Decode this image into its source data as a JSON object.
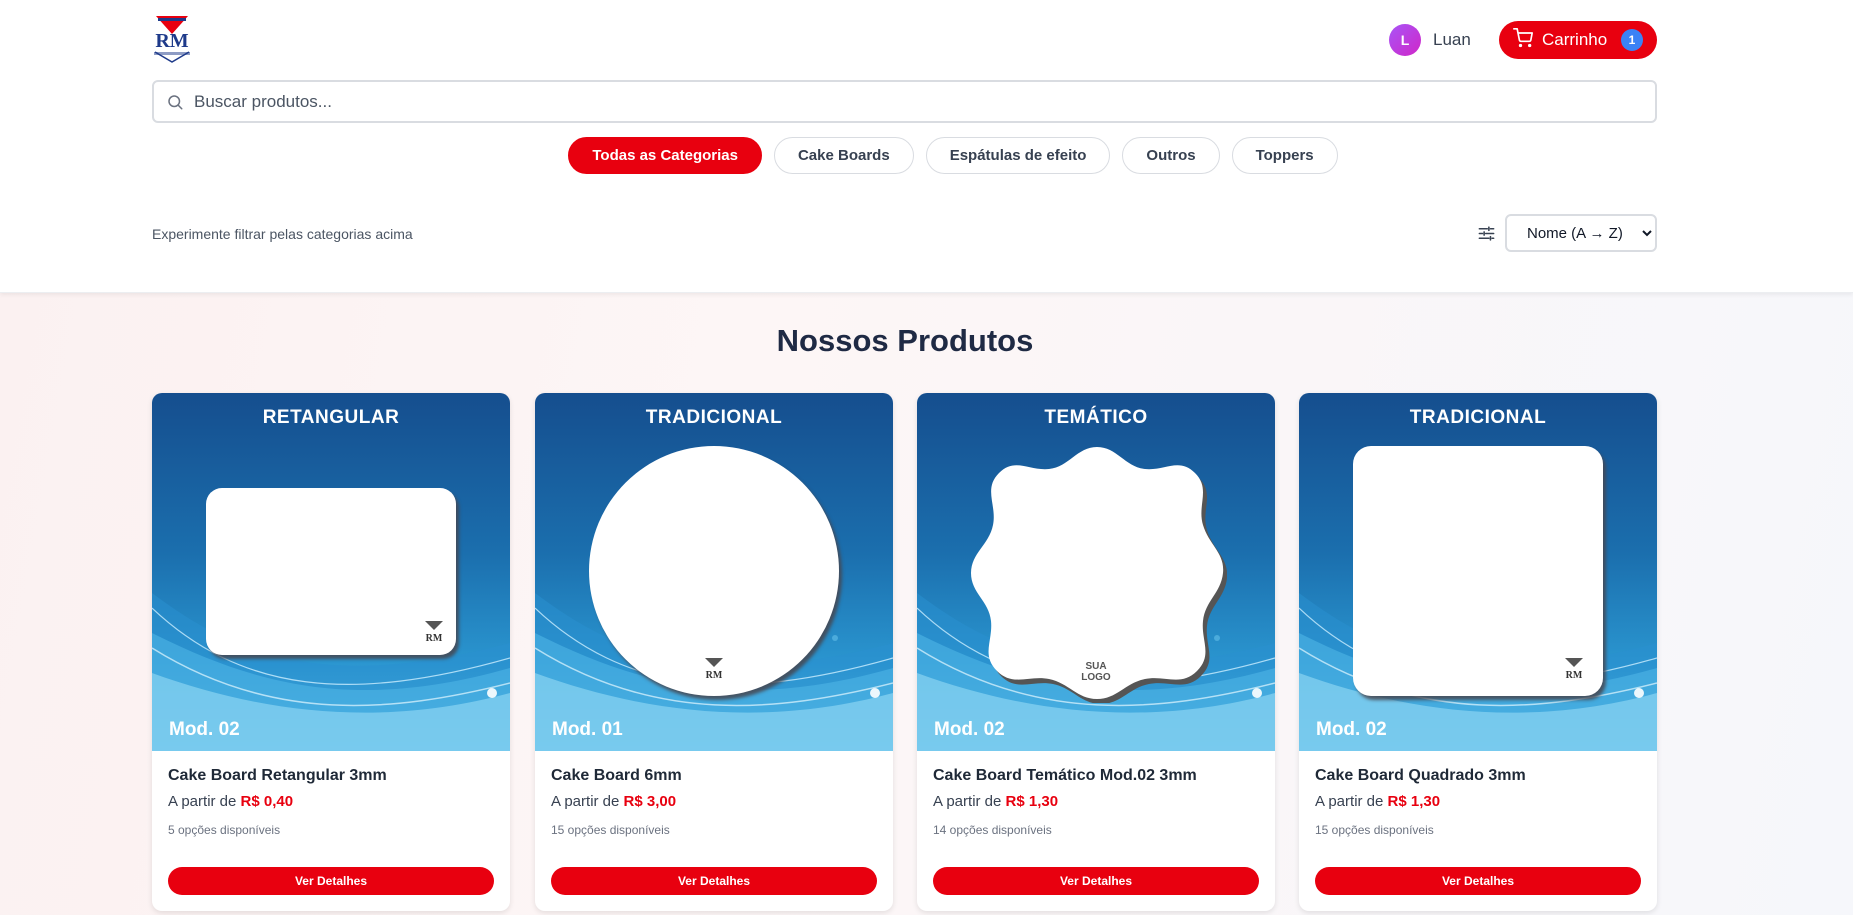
{
  "user": {
    "initial": "L",
    "name": "Luan"
  },
  "cart": {
    "label": "Carrinho",
    "count": "1"
  },
  "search": {
    "placeholder": "Buscar produtos..."
  },
  "categories": [
    "Todas as Categorias",
    "Cake Boards",
    "Espátulas de efeito",
    "Outros",
    "Toppers"
  ],
  "filters": {
    "hint": "Experimente filtrar pelas categorias acima",
    "sort_selected": "Nome (A → Z)"
  },
  "section_title": "Nossos Produtos",
  "products": [
    {
      "image_title": "RETANGULAR",
      "image_mod": "Mod. 02",
      "name": "Cake Board Retangular 3mm",
      "price_prefix": "A partir de",
      "price": "R$ 0,40",
      "options": "5 opções disponíveis",
      "button": "Ver Detalhes"
    },
    {
      "image_title": "TRADICIONAL",
      "image_mod": "Mod. 01",
      "name": "Cake Board 6mm",
      "price_prefix": "A partir de",
      "price": "R$ 3,00",
      "options": "15 opções disponíveis",
      "button": "Ver Detalhes"
    },
    {
      "image_title": "TEMÁTICO",
      "image_mod": "Mod. 02",
      "image_badge": "SUA LOGO",
      "name": "Cake Board Temático Mod.02 3mm",
      "price_prefix": "A partir de",
      "price": "R$ 1,30",
      "options": "14 opções disponíveis",
      "button": "Ver Detalhes"
    },
    {
      "image_title": "TRADICIONAL",
      "image_mod": "Mod. 02",
      "name": "Cake Board Quadrado 3mm",
      "price_prefix": "A partir de",
      "price": "R$ 1,30",
      "options": "15 opções disponíveis",
      "button": "Ver Detalhes"
    }
  ],
  "colors": {
    "brand_red": "#e8000f",
    "badge_blue": "#3b82f6",
    "card_image_blue": "#1b6fae"
  },
  "icons": {
    "logo": "rm-laser-arts-logo",
    "cart": "cart-icon",
    "search": "search-icon",
    "filter": "sliders-icon"
  }
}
